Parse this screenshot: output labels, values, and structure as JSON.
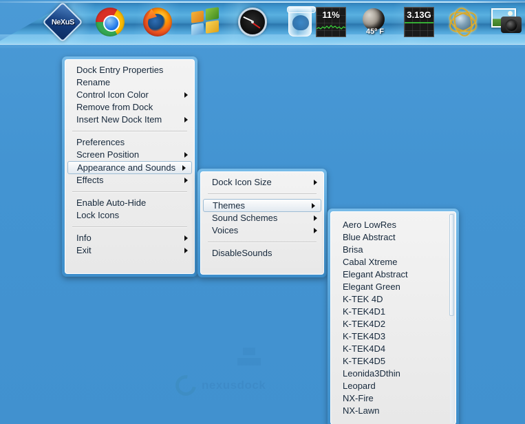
{
  "desktop": {
    "background_color": "#4394d3",
    "watermark_text": "nexusdock"
  },
  "dock": {
    "name": "Winstep Nexus Dock",
    "items": [
      {
        "name": "nexus-logo",
        "label": "NeXuS",
        "icon": "nexus-diamond-icon"
      },
      {
        "name": "google-chrome",
        "label": "Google Chrome",
        "icon": "chrome-icon"
      },
      {
        "name": "mozilla-firefox",
        "label": "Mozilla Firefox",
        "icon": "firefox-icon"
      },
      {
        "name": "windows-explorer",
        "label": "Windows",
        "icon": "windows-logo-icon"
      },
      {
        "name": "clock",
        "label": "Clock",
        "icon": "analog-clock-icon"
      },
      {
        "name": "recycle-bin",
        "label": "Recycle Bin",
        "icon": "trash-icon"
      },
      {
        "name": "cpu-meter",
        "label": "CPU Meter",
        "icon": "cpu-gauge-icon",
        "value": "11%"
      },
      {
        "name": "weather",
        "label": "Weather",
        "icon": "moon-icon",
        "value": "45º F"
      },
      {
        "name": "memory-meter",
        "label": "Memory Meter",
        "icon": "memory-gauge-icon",
        "value": "3.13G"
      },
      {
        "name": "network-meter",
        "label": "Network",
        "icon": "globe-orbit-icon"
      },
      {
        "name": "photo-camera",
        "label": "Pictures",
        "icon": "photo-camera-icon"
      }
    ]
  },
  "menu1": {
    "name": "dock-context-menu",
    "items": [
      {
        "label": "Dock Entry Properties",
        "arrow": false,
        "selected": false
      },
      {
        "label": "Rename",
        "arrow": false,
        "selected": false
      },
      {
        "label": "Control Icon Color",
        "arrow": true,
        "selected": false
      },
      {
        "label": "Remove from Dock",
        "arrow": false,
        "selected": false
      },
      {
        "label": "Insert New Dock Item",
        "arrow": true,
        "selected": false
      },
      {
        "separator": true
      },
      {
        "label": "Preferences",
        "arrow": false,
        "selected": false
      },
      {
        "label": "Screen Position",
        "arrow": true,
        "selected": false
      },
      {
        "label": "Appearance and Sounds",
        "arrow": true,
        "selected": true
      },
      {
        "label": "Effects",
        "arrow": true,
        "selected": false
      },
      {
        "separator": true
      },
      {
        "label": "Enable Auto-Hide",
        "arrow": false,
        "selected": false
      },
      {
        "label": "Lock Icons",
        "arrow": false,
        "selected": false
      },
      {
        "separator": true
      },
      {
        "label": "Info",
        "arrow": true,
        "selected": false
      },
      {
        "label": "Exit",
        "arrow": true,
        "selected": false
      }
    ]
  },
  "menu2": {
    "name": "appearance-and-sounds-submenu",
    "items": [
      {
        "label": "Dock Icon Size",
        "arrow": true,
        "selected": false
      },
      {
        "separator": true
      },
      {
        "label": "Themes",
        "arrow": true,
        "selected": true
      },
      {
        "label": "Sound Schemes",
        "arrow": true,
        "selected": false
      },
      {
        "label": "Voices",
        "arrow": true,
        "selected": false
      },
      {
        "separator": true
      },
      {
        "label": "DisableSounds",
        "arrow": false,
        "selected": false
      }
    ]
  },
  "menu3": {
    "name": "themes-submenu",
    "has_scrollbar": true,
    "items": [
      {
        "label": "Aero LowRes"
      },
      {
        "label": "Blue Abstract"
      },
      {
        "label": "Brisa"
      },
      {
        "label": "Cabal Xtreme"
      },
      {
        "label": "Elegant Abstract"
      },
      {
        "label": "Elegant Green"
      },
      {
        "label": "K-TEK 4D"
      },
      {
        "label": "K-TEK4D1"
      },
      {
        "label": "K-TEK4D2"
      },
      {
        "label": "K-TEK4D3"
      },
      {
        "label": "K-TEK4D4"
      },
      {
        "label": "K-TEK4D5"
      },
      {
        "label": "Leonida3Dthin"
      },
      {
        "label": "Leopard"
      },
      {
        "label": "NX-Fire"
      },
      {
        "label": "NX-Lawn"
      }
    ]
  },
  "colors": {
    "menu_border": "#4f9fd8",
    "menu_bg": "#eeeeee",
    "menu_text": "#16283b",
    "highlight_border": "#9dbcd4",
    "desktop": "#4394d3"
  }
}
